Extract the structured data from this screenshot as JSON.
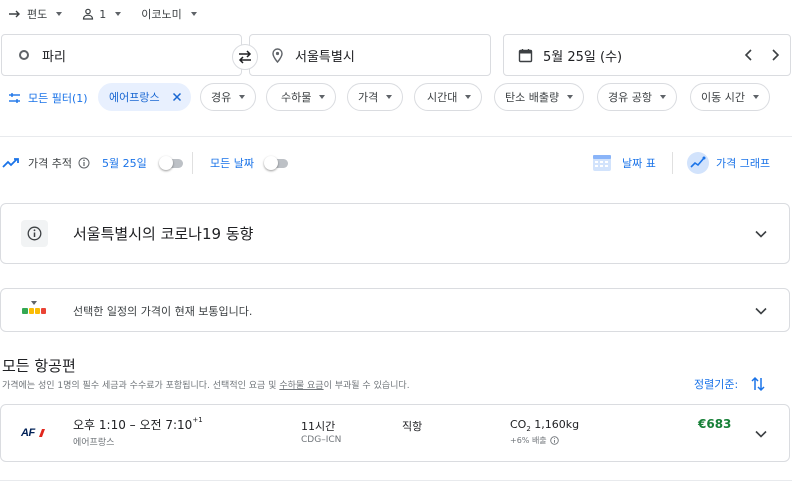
{
  "top": {
    "trip_type": "편도",
    "passengers": "1",
    "cabin": "이코노미"
  },
  "search": {
    "origin": "파리",
    "destination": "서울특별시",
    "date": "5월 25일 (수)"
  },
  "filters": {
    "all_filters": "모든 필터(1)",
    "airline_chip": "에어프랑스",
    "chips": [
      "경유",
      "수하물",
      "가격",
      "시간대",
      "탄소 배출량",
      "경유 공항",
      "이동 시간"
    ]
  },
  "tracking": {
    "label": "가격 추적",
    "date_label": "5월 25일",
    "all_dates": "모든 날짜",
    "date_grid": "날짜 표",
    "price_graph": "가격 그래프"
  },
  "covid_card": {
    "title": "서울특별시의 코로나19 동향"
  },
  "price_insight": {
    "text": "선택한 일정의 가격이 현재 보통입니다."
  },
  "flights": {
    "heading": "모든 항공편",
    "note_prefix": "가격에는 성인 1명의 필수 세금과 수수료가 포함됩니다. 선택적인 요금 및 ",
    "note_link": "수하물 요금",
    "note_suffix": "이 부과될 수 있습니다.",
    "sort_label": "정렬기준:",
    "items": [
      {
        "airline_logo": "AF",
        "time": "오후 1:10 – 오전 7:10",
        "day_offset": "+1",
        "airline": "에어프랑스",
        "duration": "11시간",
        "route": "CDG–ICN",
        "stops": "직항",
        "co2_prefix": "CO",
        "co2_sub": "2",
        "co2_value": " 1,160kg",
        "emissions": "+6% 배출",
        "price": "€683"
      }
    ]
  },
  "colors": {
    "accent": "#1a73e8",
    "price_green": "#188038",
    "chip_selected_bg": "#e8f0fe",
    "logo_red": "#e1261c",
    "logo_navy": "#002157"
  }
}
